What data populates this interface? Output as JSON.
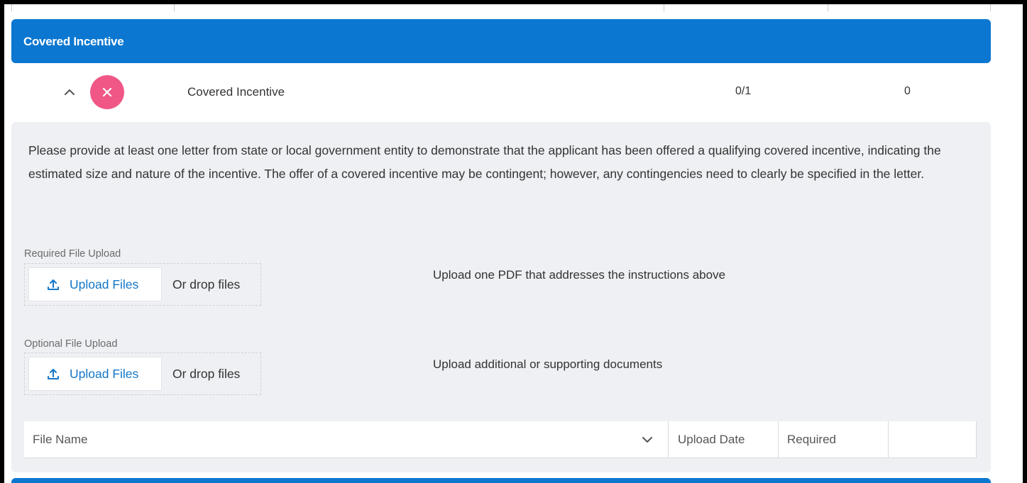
{
  "section": {
    "title": "Covered Incentive"
  },
  "summary_row": {
    "name": "Covered Incentive",
    "count": "0/1",
    "number": "0",
    "status_icon": "close-icon",
    "toggle_icon": "chevron-up-icon"
  },
  "instructions": "Please provide at least one letter from state or local government entity to demonstrate that the applicant has been offered a qualifying covered incentive, indicating the estimated size and nature of the incentive. The offer of a covered incentive may be contingent; however, any contingencies need to clearly be specified in the letter.",
  "required_upload": {
    "label": "Required File Upload",
    "button": "Upload Files",
    "drop_text": "Or drop files",
    "description": "Upload one PDF that addresses the instructions above"
  },
  "optional_upload": {
    "label": "Optional File Upload",
    "button": "Upload Files",
    "drop_text": "Or drop files",
    "description": "Upload additional or supporting documents"
  },
  "file_table": {
    "columns": [
      "File Name",
      "Upload Date",
      "Required",
      ""
    ]
  },
  "colors": {
    "header_blue": "#0b77d0",
    "status_pink": "#f05787",
    "link_blue": "#1477c9",
    "panel_gray": "#eef0f3"
  }
}
